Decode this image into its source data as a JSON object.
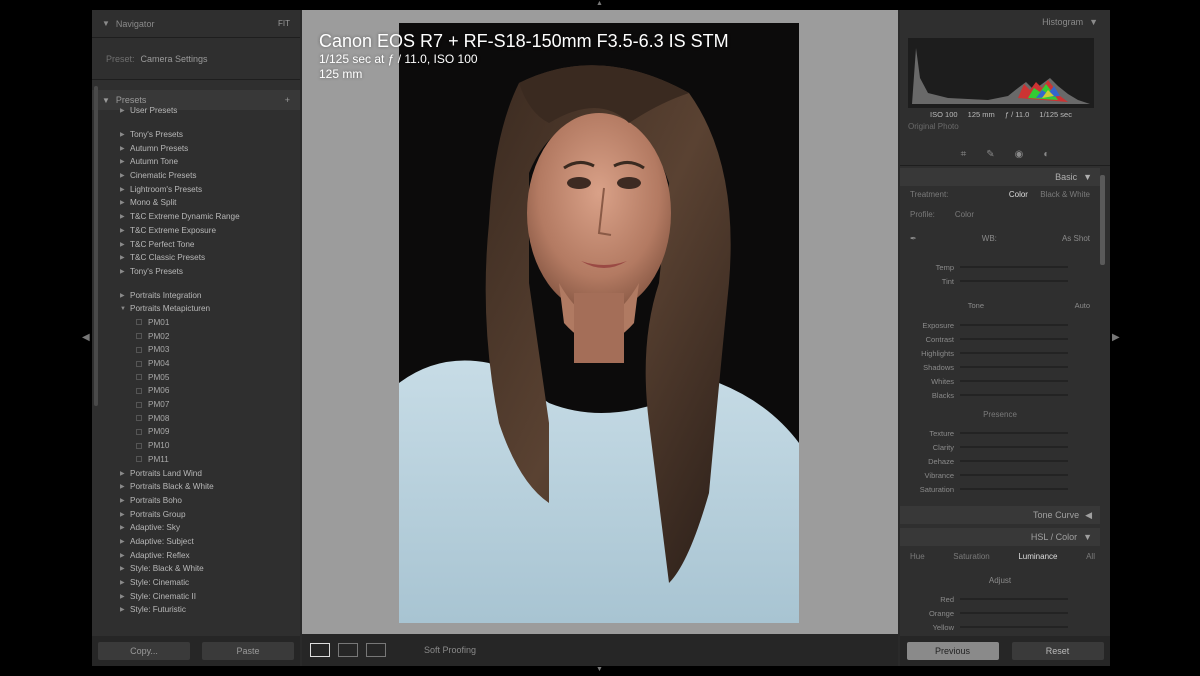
{
  "navigator": {
    "title": "Navigator",
    "fit": "FIT"
  },
  "preview": {
    "label": "Preset:",
    "value": "Camera Settings"
  },
  "presets_panel": {
    "title": "Presets",
    "add": "+"
  },
  "presets": [
    {
      "label": "User Presets",
      "sub": false,
      "gap_after": true
    },
    {
      "label": "Tony's Presets",
      "sub": false
    },
    {
      "label": "Autumn Presets",
      "sub": false
    },
    {
      "label": "Autumn Tone",
      "sub": false
    },
    {
      "label": "Cinematic Presets",
      "sub": false
    },
    {
      "label": "Lightroom's Presets",
      "sub": false
    },
    {
      "label": "Mono & Split",
      "sub": false
    },
    {
      "label": "T&C Extreme Dynamic Range",
      "sub": false
    },
    {
      "label": "T&C Extreme Exposure",
      "sub": false
    },
    {
      "label": "T&C Perfect Tone",
      "sub": false
    },
    {
      "label": "T&C Classic Presets",
      "sub": false
    },
    {
      "label": "Tony's Presets",
      "sub": false,
      "gap_after": true
    },
    {
      "label": "Portraits Integration",
      "sub": false
    },
    {
      "label": "Portraits Metapicturen",
      "sub": false,
      "open": true
    },
    {
      "label": "PM01",
      "sub": true
    },
    {
      "label": "PM02",
      "sub": true
    },
    {
      "label": "PM03",
      "sub": true
    },
    {
      "label": "PM04",
      "sub": true
    },
    {
      "label": "PM05",
      "sub": true
    },
    {
      "label": "PM06",
      "sub": true
    },
    {
      "label": "PM07",
      "sub": true
    },
    {
      "label": "PM08",
      "sub": true
    },
    {
      "label": "PM09",
      "sub": true
    },
    {
      "label": "PM10",
      "sub": true
    },
    {
      "label": "PM11",
      "sub": true
    },
    {
      "label": "Portraits Land Wind",
      "sub": false
    },
    {
      "label": "Portraits Black & White",
      "sub": false
    },
    {
      "label": "Portraits Boho",
      "sub": false
    },
    {
      "label": "Portraits Group",
      "sub": false
    },
    {
      "label": "Adaptive: Sky",
      "sub": false
    },
    {
      "label": "Adaptive: Subject",
      "sub": false
    },
    {
      "label": "Adaptive: Reflex",
      "sub": false
    },
    {
      "label": "Style: Black & White",
      "sub": false
    },
    {
      "label": "Style: Cinematic",
      "sub": false
    },
    {
      "label": "Style: Cinematic II",
      "sub": false
    },
    {
      "label": "Style: Futuristic",
      "sub": false
    }
  ],
  "left_footer": {
    "copy": "Copy...",
    "paste": "Paste"
  },
  "photo_info": {
    "camera": "Canon EOS R7 + RF-S18-150mm F3.5-6.3 IS STM",
    "exposure": "1/125 sec at ƒ / 11.0, ISO 100",
    "focal": "125 mm"
  },
  "toolbar": {
    "soft_proof": "Soft Proofing"
  },
  "histogram": {
    "title": "Histogram",
    "values": [
      "ISO 100",
      "125 mm",
      "ƒ / 11.0",
      "1/125 sec"
    ],
    "original": "Original Photo"
  },
  "basic": {
    "title": "Basic",
    "treatment_label": "Treatment:",
    "treatment_color": "Color",
    "treatment_bw": "Black & White",
    "profile_label": "Profile:",
    "profile_value": "Color",
    "wb_label": "WB:",
    "wb_value": "As Shot",
    "tone_label": "Tone",
    "tone_auto": "Auto",
    "presence_label": "Presence",
    "temp": "Temp",
    "tint": "Tint",
    "sliders": [
      "Exposure",
      "Contrast",
      "Highlights",
      "Shadows",
      "Whites",
      "Blacks"
    ],
    "presence_sliders": [
      "Texture",
      "Clarity",
      "Dehaze",
      "Vibrance",
      "Saturation"
    ]
  },
  "tone_curve": {
    "title": "Tone Curve"
  },
  "hsl": {
    "title": "HSL / Color",
    "tabs": [
      "Hue",
      "Saturation",
      "Luminance",
      "All"
    ],
    "selected_tab": "Luminance",
    "adjust_label": "Adjust",
    "sliders": [
      "Red",
      "Orange",
      "Yellow"
    ]
  },
  "right_footer": {
    "previous": "Previous",
    "reset": "Reset"
  },
  "colors": {
    "panel": "#2f2f2f",
    "center": "#9c9c9c",
    "backdrop": "#0c0b0b"
  }
}
